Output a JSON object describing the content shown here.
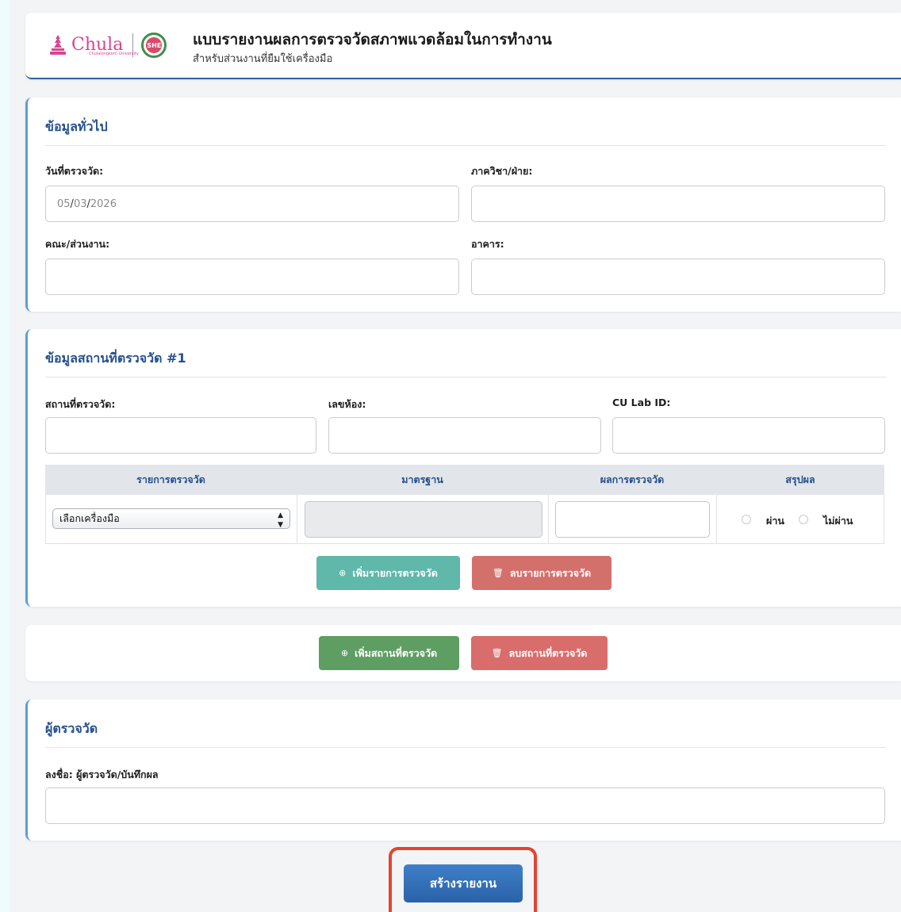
{
  "header": {
    "logo_text": "Chula",
    "logo_sub": "Chulalongkorn University",
    "she_text": "SHE",
    "title": "แบบรายงานผลการตรวจวัดสภาพแวดล้อมในการทำงาน",
    "subtitle": "สำหรับส่วนงานที่ยืมใช้เครื่องมือ"
  },
  "general": {
    "title": "ข้อมูลทั่วไป",
    "date_label": "วันที่ตรวจวัด:",
    "date_month": "05",
    "date_sep1": "/",
    "date_day": "03",
    "date_sep2": "/",
    "date_year": "2026",
    "department_label": "ภาควิชา/ฝ่าย:",
    "department_value": "",
    "faculty_label": "คณะ/ส่วนงาน:",
    "faculty_value": "",
    "building_label": "อาคาร:",
    "building_value": ""
  },
  "location": {
    "title": "ข้อมูลสถานที่ตรวจวัด #1",
    "place_label": "สถานที่ตรวจวัด:",
    "place_value": "",
    "room_label": "เลขห้อง:",
    "room_value": "",
    "lab_id_label": "CU Lab ID:",
    "lab_id_value": "",
    "table_headers": [
      "รายการตรวจวัด",
      "มาตรฐาน",
      "ผลการตรวจวัด",
      "สรุปผล"
    ],
    "row": {
      "instrument_select": "เลือกเครื่องมือ",
      "standard_value": "",
      "result_value": "",
      "pass_label": "ผ่าน",
      "fail_label": "ไม่ผ่าน"
    },
    "add_item_button": "เพิ่มรายการตรวจวัด",
    "remove_item_button": "ลบรายการตรวจวัด"
  },
  "location_actions": {
    "add_location_button": "เพิ่มสถานที่ตรวจวัด",
    "remove_location_button": "ลบสถานที่ตรวจวัด"
  },
  "inspector": {
    "title": "ผู้ตรวจวัด",
    "signature_label": "ลงชื่อ: ผู้ตรวจวัด/บันทึกผล",
    "signature_value": ""
  },
  "submit_button": "สร้างรายงาน",
  "colors": {
    "accent_blue": "#25508c",
    "teal": "#5fb8a9",
    "red": "#d4706c",
    "green": "#5f9e63",
    "primary": "#2f6db5",
    "highlight": "#e5432f"
  }
}
